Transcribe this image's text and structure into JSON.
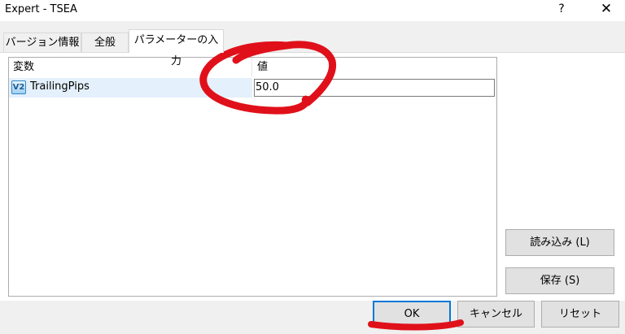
{
  "window": {
    "title": "Expert - TSEA",
    "help_label": "?",
    "close_label": "✕"
  },
  "tabs": [
    {
      "label": "バージョン情報"
    },
    {
      "label": "全般"
    },
    {
      "label": "パラメーターの入力",
      "active": true
    }
  ],
  "params": {
    "col_variable": "変数",
    "col_value": "値",
    "rows": [
      {
        "icon": "variable-double-icon",
        "icon_text": "V2",
        "name": "TrailingPips",
        "value": "50.0"
      }
    ]
  },
  "side_buttons": {
    "load": "読み込み (L)",
    "save": "保存 (S)"
  },
  "footer": {
    "ok": "OK",
    "cancel": "キャンセル",
    "reset": "リセット"
  },
  "colors": {
    "annotation": "#e0101a",
    "default_button_border": "#0078d7"
  }
}
